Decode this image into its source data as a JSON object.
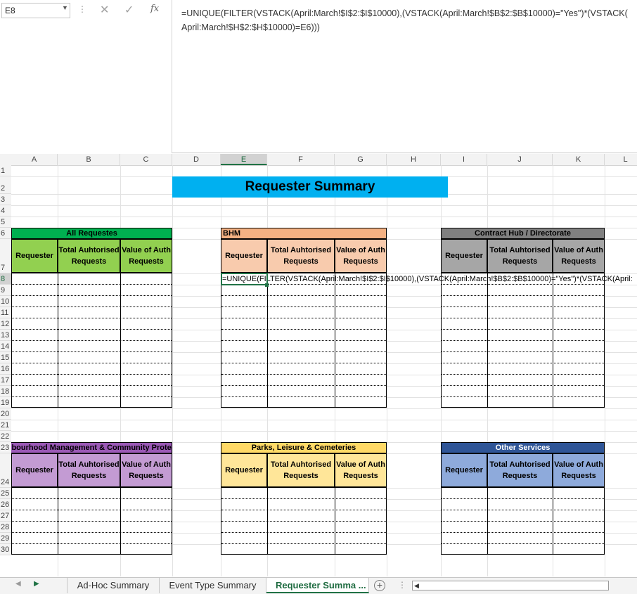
{
  "namebox": {
    "value": "E8"
  },
  "formula_bar": {
    "cancel": "✕",
    "enter": "✓",
    "fx": "fx",
    "text": "=UNIQUE(FILTER(VSTACK(April:March!$I$2:$I$10000),(VSTACK(April:March!$B$2:$B$10000)=\"Yes\")*(VSTACK(\nApril:March!$H$2:$H$10000)=E6)))"
  },
  "columns": [
    "A",
    "B",
    "C",
    "D",
    "E",
    "F",
    "G",
    "H",
    "I",
    "J",
    "K",
    "L"
  ],
  "rows": [
    "1",
    "2",
    "3",
    "4",
    "5",
    "6",
    "7",
    "8",
    "9",
    "10",
    "11",
    "12",
    "13",
    "14",
    "15",
    "16",
    "17",
    "18",
    "19",
    "20",
    "21",
    "22",
    "23",
    "24",
    "25",
    "26",
    "27",
    "28",
    "29",
    "30"
  ],
  "sheet": {
    "title": "Requester Summary",
    "overflow_formula": "=UNIQUE(FILTER(VSTACK(April:March!$I$2:$I$10000),(VSTACK(April:March!$B$2:$B$10000)=\"Yes\")*(VSTACK(April:",
    "blocks": [
      {
        "title": "All Requestes",
        "title_align": "center",
        "title_color": "#00b050",
        "head_color": "#92d050",
        "headers": [
          "Requester",
          "Total Auhtorised Requests",
          "Value of Auth Requests"
        ]
      },
      {
        "title": "BHM",
        "title_align": "left",
        "title_color": "#f4b183",
        "head_color": "#f8cbad",
        "headers": [
          "Requester",
          "Total Auhtorised Requests",
          "Value of Auth Requests"
        ]
      },
      {
        "title": "Contract Hub / Directorate",
        "title_align": "center",
        "title_color": "#808080",
        "head_color": "#a6a6a6",
        "headers": [
          "Requester",
          "Total Auhtorised Requests",
          "Value of Auth Requests"
        ]
      },
      {
        "title": "ghbourhood Management & Community Protec",
        "title_align": "left",
        "title_color": "#9b59b6",
        "head_color": "#c39bd3",
        "headers": [
          "Requester",
          "Total Auhtorised Requests",
          "Value of Auth Requests"
        ]
      },
      {
        "title": "Parks, Leisure & Cemeteries",
        "title_align": "center",
        "title_color": "#ffd966",
        "head_color": "#ffe699",
        "headers": [
          "Requester",
          "Total Auhtorised Requests",
          "Value of Auth Requests"
        ]
      },
      {
        "title": "Other Services",
        "title_align": "center",
        "title_color": "#2f5597",
        "head_color": "#8eaadb",
        "title_text_color": "#ffffff",
        "headers": [
          "Requester",
          "Total Auhtorised Requests",
          "Value of Auth Requests"
        ]
      }
    ]
  },
  "tabs": {
    "items": [
      {
        "label": "Ad-Hoc Summary",
        "active": false
      },
      {
        "label": "Event Type Summary",
        "active": false
      },
      {
        "label": "Requester Summa",
        "active": true
      }
    ],
    "more": "...",
    "add": "+",
    "dots": "⋮",
    "nav_prev": "◀",
    "nav_next": "▶",
    "scroll_left": "◀"
  },
  "icons": [
    "chevron-down-icon",
    "cancel-icon",
    "check-icon",
    "function-icon",
    "add-sheet-icon"
  ]
}
